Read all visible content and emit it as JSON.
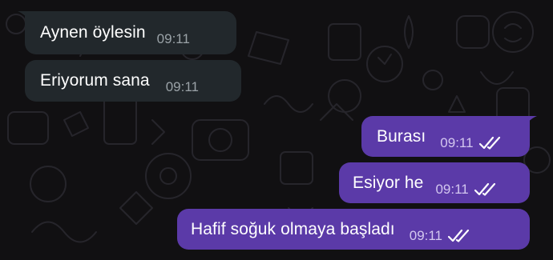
{
  "chat": {
    "messages": [
      {
        "text": "Aynen öylesin",
        "time": "09:11",
        "direction": "incoming"
      },
      {
        "text": "Eriyorum sana",
        "time": "09:11",
        "direction": "incoming"
      },
      {
        "text": "Burası",
        "time": "09:11",
        "direction": "outgoing",
        "status": "read"
      },
      {
        "text": "Esiyor he",
        "time": "09:11",
        "direction": "outgoing",
        "status": "read"
      },
      {
        "text": "Hafif soğuk olmaya başladı",
        "time": "09:11",
        "direction": "outgoing",
        "status": "read"
      }
    ]
  },
  "colors": {
    "background": "#111012",
    "incoming_bubble": "#22282c",
    "outgoing_bubble": "#5b3aa8",
    "read_tick": "#ffffff"
  },
  "icons": {
    "read_receipt": "double-check-icon"
  }
}
